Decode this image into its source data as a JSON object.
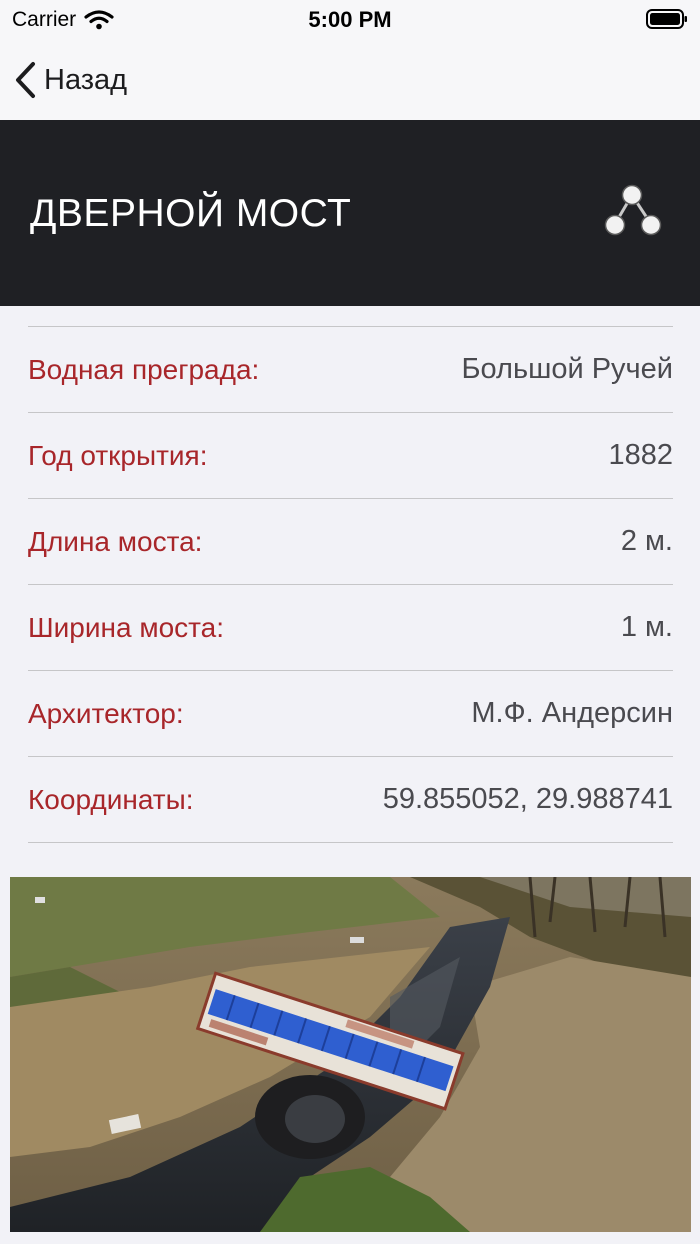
{
  "status_bar": {
    "carrier": "Carrier",
    "time": "5:00 PM"
  },
  "nav": {
    "back_label": "Назад"
  },
  "header": {
    "title": "ДВЕРНОЙ МОСТ"
  },
  "details": [
    {
      "label": "Водная преграда:",
      "value": "Большой Ручей"
    },
    {
      "label": "Год открытия:",
      "value": "1882"
    },
    {
      "label": "Длина моста:",
      "value": "2 м."
    },
    {
      "label": "Ширина моста:",
      "value": "1 м."
    },
    {
      "label": "Архитектор:",
      "value": "М.Ф. Андерсин"
    },
    {
      "label": "Координаты:",
      "value": "59.855052, 29.988741"
    }
  ],
  "colors": {
    "accent": "#a8262a",
    "header_bg": "#1f2024",
    "background": "#f2f2f7"
  },
  "icons": [
    "wifi-icon",
    "battery-icon",
    "back-chevron-icon",
    "share-icon"
  ]
}
